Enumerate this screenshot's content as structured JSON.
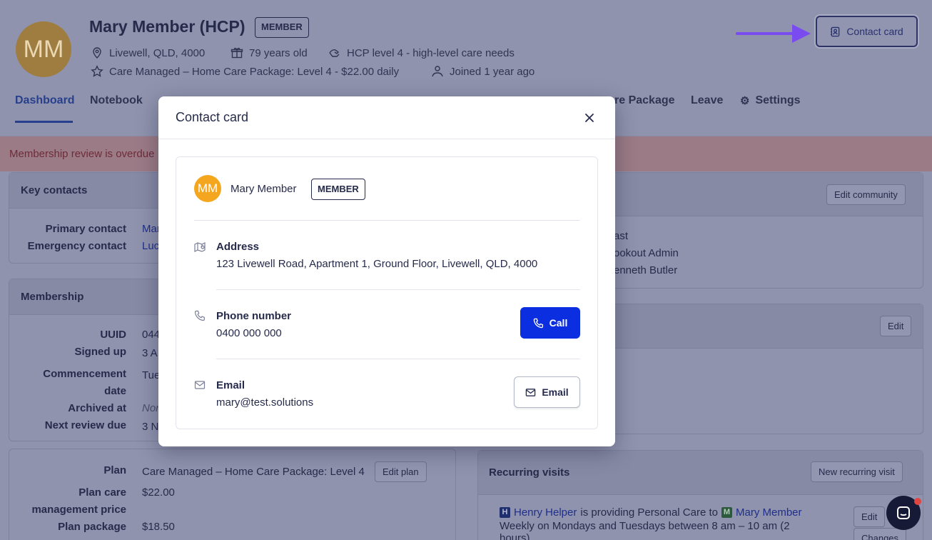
{
  "member": {
    "initials": "MM",
    "name": "Mary Member (HCP)",
    "badge": "MEMBER",
    "location": "Livewell, QLD, 4000",
    "age": "79 years old",
    "care_level": "HCP level 4 - high-level care needs",
    "package": "Care Managed – Home Care Package: Level 4 - $22.00 daily",
    "joined": "Joined 1 year ago"
  },
  "header": {
    "contact_card_label": "Contact card"
  },
  "tabs": [
    {
      "label": "Dashboard",
      "active": true
    },
    {
      "label": "Notebook",
      "active": false
    },
    {
      "label": "re Package",
      "active": false
    },
    {
      "label": "Leave",
      "active": false
    },
    {
      "label": "Settings",
      "active": false
    }
  ],
  "banner": {
    "text": "Membership review is overdue"
  },
  "key_contacts": {
    "title": "Key contacts",
    "rows": [
      {
        "label": "Primary contact",
        "value": "Mar"
      },
      {
        "label": "Emergency contact",
        "value": "Luc"
      }
    ]
  },
  "community": {
    "edit_label": "Edit community",
    "lines": [
      "ast",
      "ookout Admin",
      "enneth Butler"
    ]
  },
  "membership": {
    "title": "Membership",
    "rows": [
      {
        "label": "UUID",
        "value": "044"
      },
      {
        "label": "Signed up",
        "value": "3 A"
      },
      {
        "label": "Commencement",
        "value": "Tue"
      },
      {
        "label": "date",
        "value": ""
      },
      {
        "label": "Archived at",
        "value": "Non"
      },
      {
        "label": "Next review due",
        "value": "3 N"
      }
    ],
    "edit_label": "Edit"
  },
  "plan": {
    "rows": [
      {
        "label": "Plan",
        "value": "Care Managed – Home Care Package: Level 4"
      },
      {
        "label": "Plan care",
        "value": "$22.00"
      },
      {
        "label": "management price",
        "value": ""
      },
      {
        "label": "Plan package",
        "value": "$18.50"
      }
    ],
    "edit_plan_label": "Edit plan"
  },
  "recurring_visits": {
    "title": "Recurring visits",
    "new_label": "New recurring visit",
    "helper": "Henry Helper",
    "middle": "is providing Personal Care to",
    "member": "Mary Member",
    "schedule": "Weekly on Mondays and Tuesdays between 8 am – 10 am (2",
    "schedule2": "hours)",
    "edit_label": "Edit",
    "changes_label": "Changes"
  },
  "modal": {
    "title": "Contact card",
    "name": "Mary Member",
    "badge": "MEMBER",
    "initials": "MM",
    "address_label": "Address",
    "address_value": "123 Livewell Road, Apartment 1, Ground Floor, Livewell, QLD, 4000",
    "phone_label": "Phone number",
    "phone_value": "0400 000 000",
    "call_label": "Call",
    "email_label": "Email",
    "email_value": "mary@test.solutions",
    "email_button": "Email"
  },
  "colors": {
    "primary": "#0a2ee0",
    "avatar": "#f4a61f",
    "arrow": "#7a4cf0",
    "chat_dot": "#e0453f"
  },
  "icons": [
    "location-icon",
    "gift-icon",
    "care-icon",
    "star-icon",
    "joined-icon",
    "contact-card-icon",
    "settings-icon",
    "close-icon",
    "map-icon",
    "phone-icon",
    "mail-icon",
    "chat-icon"
  ]
}
